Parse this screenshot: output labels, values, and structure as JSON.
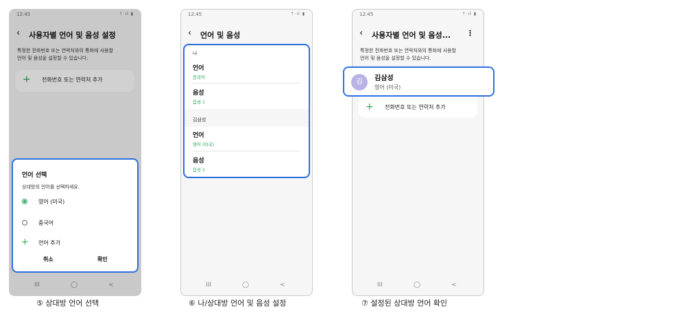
{
  "status": {
    "time": "12:45",
    "icons": "⇡⋅ıl ▮"
  },
  "nav": {
    "recent": "III",
    "home": "◯",
    "back": "<"
  },
  "screen1": {
    "title": "사용자별 언어 및 음성 설정",
    "desc_line1": "특정한 전화번호 또는 연락처와의 통화에 사용할",
    "desc_line2": "언어 및 음성을 설정할 수 있습니다.",
    "add_label": "전화번호 또는 연락처 추가",
    "sheet": {
      "title": "언어 선택",
      "subtitle": "상대방의 언어를 선택하세요.",
      "options": [
        {
          "label": "영어 (미국)",
          "selected": true
        },
        {
          "label": "중국어",
          "selected": false
        }
      ],
      "add_language": "언어 추가",
      "cancel": "취소",
      "ok": "확인"
    }
  },
  "screen2": {
    "title": "언어 및 음성",
    "sections": [
      {
        "header": "나",
        "rows": [
          {
            "key": "언어",
            "value": "한국어"
          },
          {
            "key": "음성",
            "value": "음성 1"
          }
        ]
      },
      {
        "header": "김삼성",
        "rows": [
          {
            "key": "언어",
            "value": "영어 (미국)"
          },
          {
            "key": "음성",
            "value": "음성 1"
          }
        ]
      }
    ]
  },
  "screen3": {
    "title": "사용자별 언어 및 음성...",
    "desc_line1": "특정한 전화번호 또는 연락처와의 통화에 사용할",
    "desc_line2": "언어 및 음성을 설정할 수 있습니다.",
    "contact": {
      "avatar": "김",
      "name": "김삼성",
      "language": "영어 (미국)"
    },
    "add_label": "전화번호 또는 연락처 추가"
  },
  "captions": {
    "c1": "⑤ 상대방 언어 선택",
    "c2": "⑥ 나/상대방 언어 및 음성 설정",
    "c3": "⑦ 설정된 상대방 언어 확인"
  },
  "colors": {
    "accent_green": "#2aa35a",
    "highlight_blue": "#2e6fe0",
    "avatar": "#b9b2e6"
  }
}
